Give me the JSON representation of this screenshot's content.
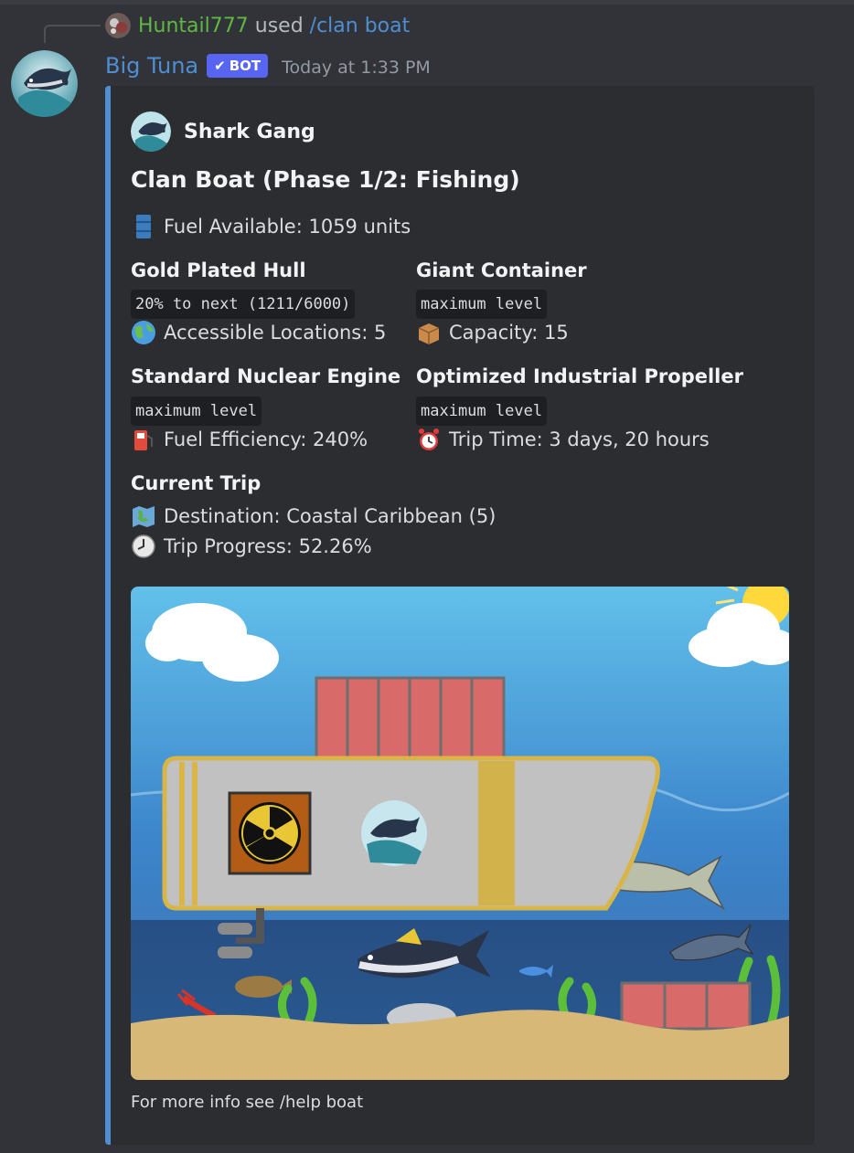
{
  "reply": {
    "username": "Huntail777",
    "used_text": "used",
    "command": "/clan boat"
  },
  "message": {
    "author": "Big Tuna",
    "bot_badge": "BOT",
    "timestamp": "Today at 1:33 PM"
  },
  "embed": {
    "author_name": "Shark Gang",
    "title": "Clan Boat (Phase 1/2: Fishing)",
    "fuel_line": "Fuel Available: 1059 units",
    "fields": [
      {
        "name": "Gold Plated Hull",
        "code": "20% to next (1211/6000)",
        "detail": "Accessible Locations: 5",
        "icon": "globe-icon"
      },
      {
        "name": "Giant Container",
        "code": "maximum level",
        "detail": "Capacity: 15",
        "icon": "package-icon"
      },
      {
        "name": "Standard Nuclear Engine",
        "code": "maximum level",
        "detail": "Fuel Efficiency: 240%",
        "icon": "fuel-pump-icon"
      },
      {
        "name": "Optimized Industrial Propeller",
        "code": "maximum level",
        "detail": "Trip Time: 3 days, 20 hours",
        "icon": "alarm-clock-icon"
      }
    ],
    "current_trip": {
      "name": "Current Trip",
      "destination": "Destination: Coastal Caribbean (5)",
      "progress": "Trip Progress: 52.26%"
    },
    "footer": "For more info see /help boat"
  },
  "colors": {
    "accent": "#4e8fd2",
    "username_green": "#5fb843",
    "bot_badge": "#5865f2"
  }
}
